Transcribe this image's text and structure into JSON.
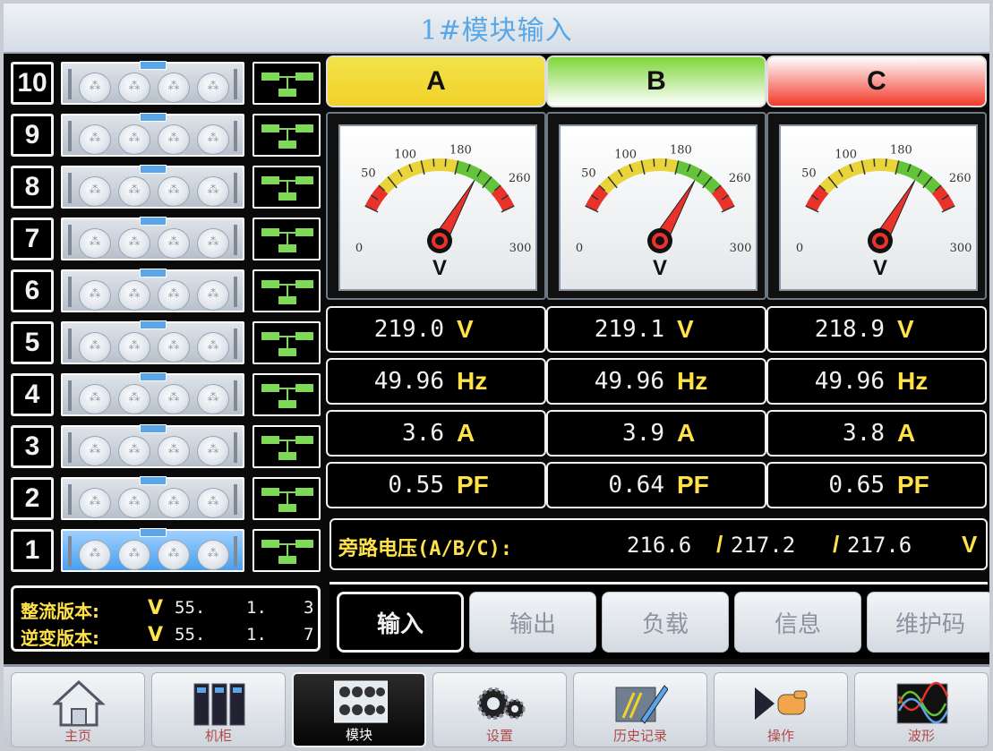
{
  "title": "1#模块输入",
  "racks": [
    {
      "num": "10",
      "active": false
    },
    {
      "num": "9",
      "active": false
    },
    {
      "num": "8",
      "active": false
    },
    {
      "num": "7",
      "active": false
    },
    {
      "num": "6",
      "active": false
    },
    {
      "num": "5",
      "active": false
    },
    {
      "num": "4",
      "active": false
    },
    {
      "num": "3",
      "active": false
    },
    {
      "num": "2",
      "active": false
    },
    {
      "num": "1",
      "active": true
    }
  ],
  "versions": {
    "rectifier": {
      "label": "整流版本:",
      "v": "V",
      "a": "55.",
      "b": "1.",
      "c": "3"
    },
    "inverter": {
      "label": "逆变版本:",
      "v": "V",
      "a": "55.",
      "b": "1.",
      "c": "7"
    }
  },
  "phases": [
    {
      "name": "A",
      "gauge_value": 219.0,
      "voltage": "219.0",
      "voltage_unit": "V",
      "freq": "49.96",
      "freq_unit": "Hz",
      "current": "3.6",
      "current_unit": "A",
      "pf": "0.55",
      "pf_unit": "PF",
      "color_left": "#f2e24a",
      "color_right": "#f2d22a"
    },
    {
      "name": "B",
      "gauge_value": 219.1,
      "voltage": "219.1",
      "voltage_unit": "V",
      "freq": "49.96",
      "freq_unit": "Hz",
      "current": "3.9",
      "current_unit": "A",
      "pf": "0.64",
      "pf_unit": "PF",
      "color_left": "#7fd63a",
      "color_right": "#ffffff"
    },
    {
      "name": "C",
      "gauge_value": 218.9,
      "voltage": "218.9",
      "voltage_unit": "V",
      "freq": "49.96",
      "freq_unit": "Hz",
      "current": "3.8",
      "current_unit": "A",
      "pf": "0.65",
      "pf_unit": "PF",
      "color_left": "#ffffff",
      "color_right": "#f2392a"
    }
  ],
  "gauge": {
    "min": 0,
    "max": 300,
    "unit": "V",
    "tick_labels": [
      "0",
      "50",
      "100",
      "180",
      "260",
      "300"
    ],
    "tick_values": [
      0,
      50,
      100,
      180,
      260,
      300
    ],
    "zones": [
      {
        "from": 0,
        "to": 40,
        "color": "#e8322a"
      },
      {
        "from": 40,
        "to": 180,
        "color": "#e9d43a"
      },
      {
        "from": 180,
        "to": 260,
        "color": "#63c43a"
      },
      {
        "from": 260,
        "to": 300,
        "color": "#e8322a"
      }
    ]
  },
  "bypass": {
    "label": "旁路电压(A/B/C):",
    "a": "216.6",
    "b": "217.2",
    "c": "217.6",
    "slash": "/",
    "unit": "V"
  },
  "tabs": [
    {
      "label": "输入",
      "active": true
    },
    {
      "label": "输出",
      "active": false
    },
    {
      "label": "负载",
      "active": false
    },
    {
      "label": "信息",
      "active": false
    },
    {
      "label": "维护码",
      "active": false
    }
  ],
  "nav": [
    {
      "label": "主页",
      "icon": "home-icon",
      "active": false
    },
    {
      "label": "机柜",
      "icon": "cabinet-icon",
      "active": false
    },
    {
      "label": "模块",
      "icon": "module-icon",
      "active": true
    },
    {
      "label": "设置",
      "icon": "gears-icon",
      "active": false
    },
    {
      "label": "历史记录",
      "icon": "history-pen-icon",
      "active": false
    },
    {
      "label": "操作",
      "icon": "pointing-hand-icon",
      "active": false
    },
    {
      "label": "波形",
      "icon": "waveform-icon",
      "active": false
    }
  ]
}
